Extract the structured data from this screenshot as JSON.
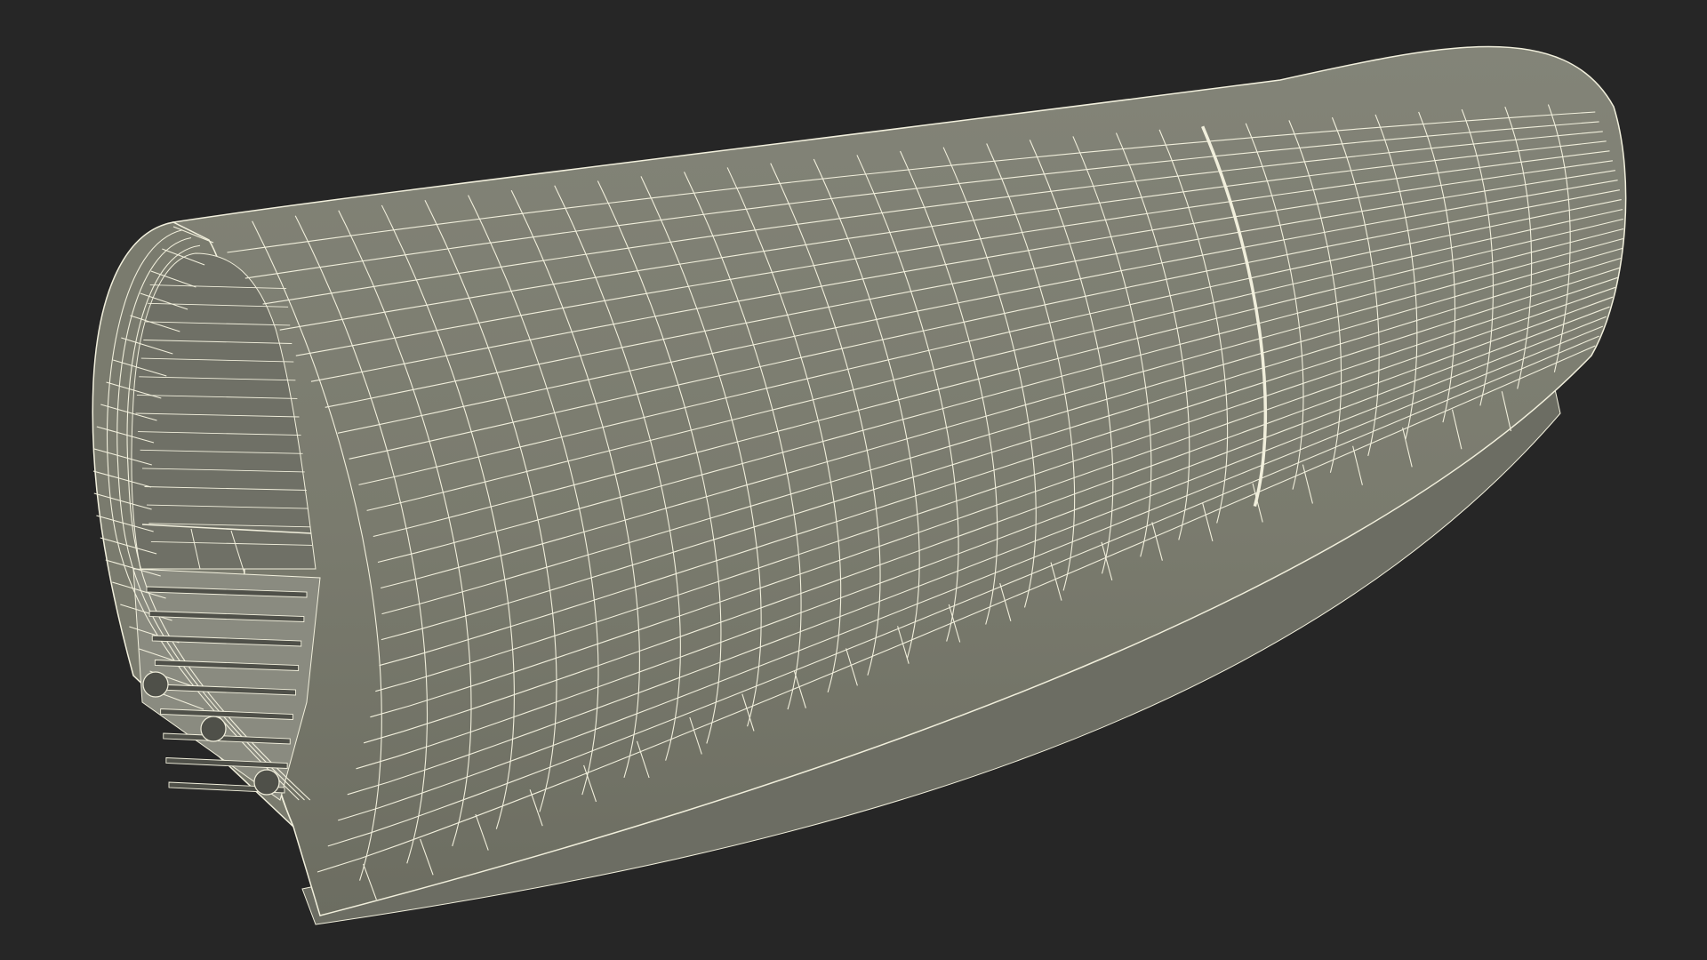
{
  "scene": {
    "subject": "tunnel-section-wireframe",
    "colors": {
      "background": "#262626",
      "outer_surface": "#7a7b6e",
      "outer_surface_light": "#838478",
      "outer_surface_dark": "#6c6d61",
      "inner_surface": "#6f7066",
      "inner_shadow": "#4f5049",
      "base_slab": "#6c6d63",
      "track_bed": "#8a8b80",
      "wire": "#f1efdc"
    }
  }
}
